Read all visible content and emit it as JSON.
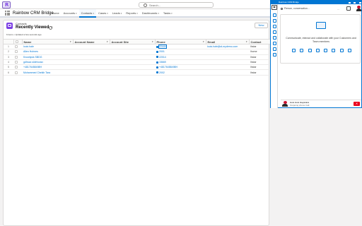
{
  "global_search": {
    "placeholder": "Search..."
  },
  "app": {
    "logo_letter": "R",
    "name": "Rainbow CRM Bridge"
  },
  "nav": {
    "items": [
      {
        "label": "Home",
        "has_menu": false,
        "active": false
      },
      {
        "label": "Accounts",
        "has_menu": true,
        "active": false
      },
      {
        "label": "Contacts",
        "has_menu": true,
        "active": true
      },
      {
        "label": "Cases",
        "has_menu": true,
        "active": false
      },
      {
        "label": "Leads",
        "has_menu": true,
        "active": false
      },
      {
        "label": "Reports",
        "has_menu": true,
        "active": false
      },
      {
        "label": "Dashboards",
        "has_menu": true,
        "active": false
      },
      {
        "label": "Tasks",
        "has_menu": true,
        "active": false
      }
    ]
  },
  "list_view": {
    "object_label": "Contacts",
    "view_name": "Recently Viewed",
    "new_button": "New",
    "meta": "6 items • Updated a few seconds ago",
    "columns": [
      "Name",
      "Account Name",
      "Account Site",
      "Phone",
      "Email",
      "Contact"
    ],
    "rows": [
      {
        "num": "1",
        "name": "louis hale",
        "account_name": "",
        "account_site": "",
        "phone": "22444",
        "email": "louis.hale@al-mydemo.com",
        "owner": "lhstar",
        "selected": true
      },
      {
        "num": "2",
        "name": "Allen Hohnes",
        "account_name": "",
        "account_site": "",
        "phone": "2001",
        "email": "",
        "owner": "lhome",
        "selected": false
      },
      {
        "num": "3",
        "name": "Knowlysis SBDG",
        "account_name": "",
        "account_site": "",
        "phone": "22014",
        "email": "",
        "owner": "lhstar",
        "selected": false
      },
      {
        "num": "4",
        "name": "gdhsza sldehoosx",
        "account_name": "",
        "account_site": "",
        "phone": "15669",
        "email": "",
        "owner": "lhstar",
        "selected": false
      },
      {
        "num": "5",
        "name": "+48176458498H",
        "account_name": "",
        "account_site": "",
        "phone": "+48176458498H",
        "email": "",
        "owner": "lhstar",
        "selected": false
      },
      {
        "num": "6",
        "name": "Mohammed Cheikh Tara",
        "account_name": "",
        "account_site": "",
        "phone": "2002",
        "email": "",
        "owner": "lhstar",
        "selected": false
      }
    ]
  },
  "widget": {
    "title": "Rainbow CRM Bridge",
    "search_placeholder": "Person, conversation...",
    "more_label": "...",
    "empty_text": "Communicate, interact and collaborate with your Customers and Team members",
    "toast": {
      "name": "louis louis Hayanara",
      "status": "Outgoing phone Call",
      "end_label": "✕"
    }
  },
  "colors": {
    "brand": "#0176d3",
    "accent_purple": "#7b3fe4",
    "hangup": "#ea001e"
  }
}
